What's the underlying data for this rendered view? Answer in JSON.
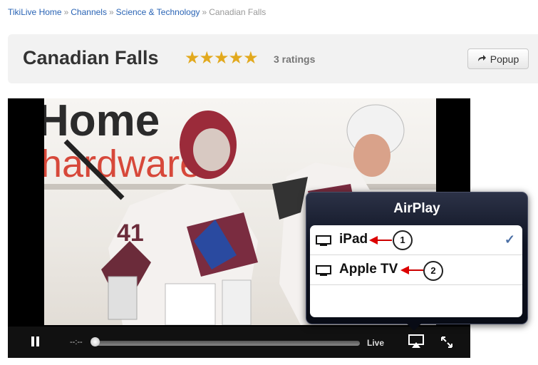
{
  "breadcrumb": {
    "items": [
      "TikiLive Home",
      "Channels",
      "Science & Technology"
    ],
    "current": "Canadian Falls",
    "separator": "»"
  },
  "header": {
    "title": "Canadian Falls",
    "stars": "★★★★★",
    "rating_count": "3 ratings",
    "popup_label": "Popup"
  },
  "player": {
    "time": "--:--",
    "live_label": "Live",
    "progress": 0
  },
  "airplay": {
    "title": "AirPlay",
    "devices": [
      {
        "name": "iPad",
        "selected": true,
        "callout": "1"
      },
      {
        "name": "Apple TV",
        "selected": false,
        "callout": "2"
      }
    ],
    "check": "✓"
  },
  "icons": {
    "pause": "pause-icon",
    "airplay": "airplay-icon",
    "fullscreen": "fullscreen-icon",
    "device": "monitor-icon",
    "popup": "share-arrow-icon"
  },
  "colors": {
    "link": "#2a64b5",
    "star": "#e2a91e",
    "callout_arrow": "#d00000"
  }
}
